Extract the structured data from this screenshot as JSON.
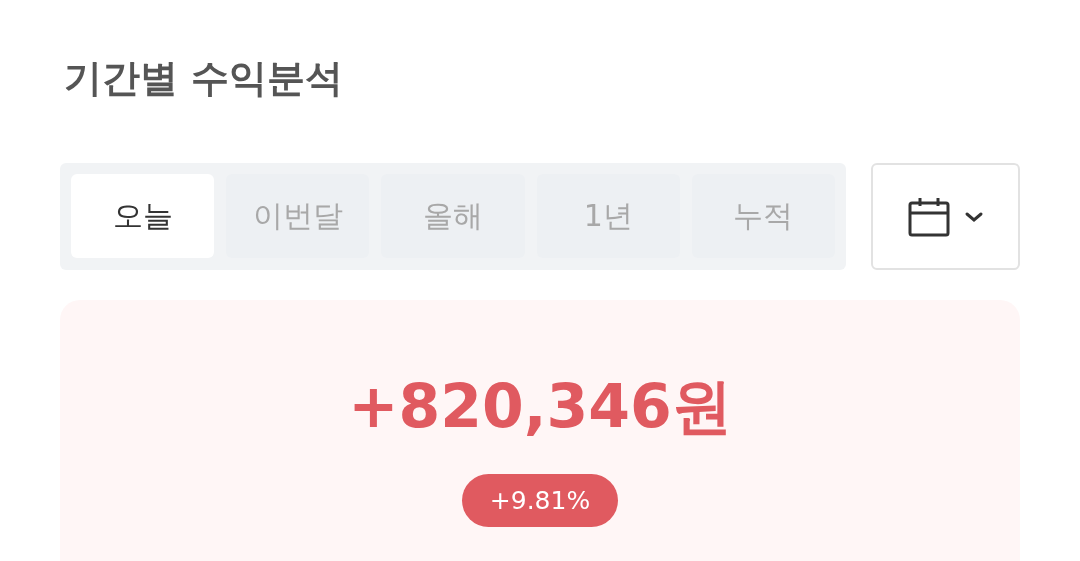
{
  "title": "기간별 수익분석",
  "tabs": [
    {
      "label": "오늘",
      "selected": true
    },
    {
      "label": "이번달",
      "selected": false
    },
    {
      "label": "올해",
      "selected": false
    },
    {
      "label": "1년",
      "selected": false
    },
    {
      "label": "누적",
      "selected": false
    }
  ],
  "summary": {
    "amount": "+820,346원",
    "change": "+9.81%"
  }
}
